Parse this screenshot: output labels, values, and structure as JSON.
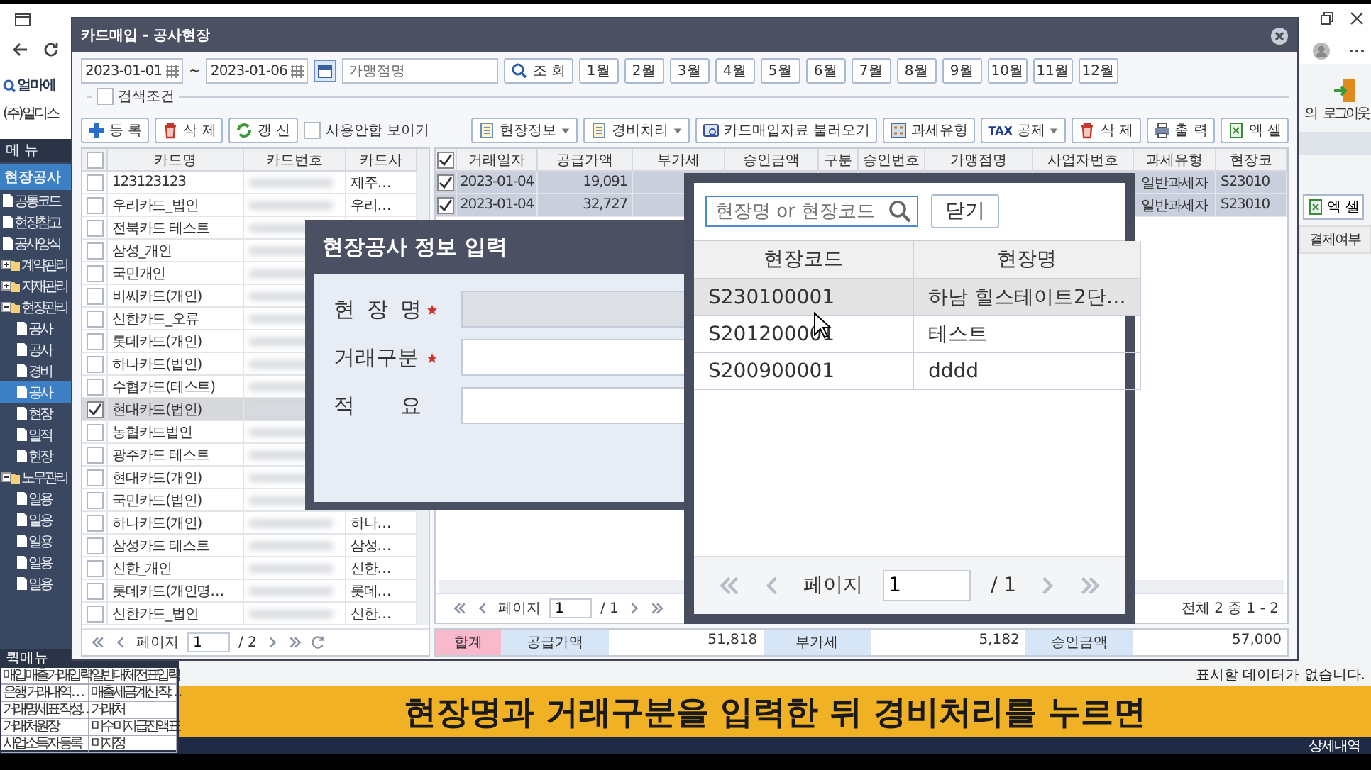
{
  "background_app": {
    "logo": "얼마에",
    "company": "(주)얼디스",
    "menu_header": "메 뉴",
    "section": "현장공사",
    "tree": [
      {
        "label": "공통코드",
        "kind": "doc",
        "selected": false
      },
      {
        "label": "현장참고",
        "kind": "doc",
        "selected": false
      },
      {
        "label": "공사양식",
        "kind": "doc",
        "selected": false
      },
      {
        "label": "계약관리",
        "kind": "folder",
        "expanded": false,
        "selected": false
      },
      {
        "label": "자재관리",
        "kind": "folder",
        "expanded": false,
        "selected": false
      },
      {
        "label": "현장관리",
        "kind": "folder",
        "expanded": true,
        "selected": false,
        "children": [
          {
            "label": "공사",
            "kind": "doc",
            "selected": false
          },
          {
            "label": "공사",
            "kind": "doc",
            "selected": false
          },
          {
            "label": "경비",
            "kind": "doc",
            "selected": false
          },
          {
            "label": "공사",
            "kind": "doc",
            "selected": true
          },
          {
            "label": "현장",
            "kind": "doc",
            "selected": false
          },
          {
            "label": "일적",
            "kind": "doc",
            "selected": false
          },
          {
            "label": "현장",
            "kind": "doc",
            "selected": false
          }
        ]
      },
      {
        "label": "노무관리",
        "kind": "folder",
        "expanded": true,
        "selected": false,
        "children": [
          {
            "label": "일용",
            "kind": "doc",
            "selected": false
          },
          {
            "label": "일용",
            "kind": "doc",
            "selected": false
          },
          {
            "label": "일용",
            "kind": "doc",
            "selected": false
          },
          {
            "label": "일용",
            "kind": "doc",
            "selected": false
          },
          {
            "label": "일용",
            "kind": "doc",
            "selected": false
          }
        ]
      }
    ],
    "header_actions": [
      "의",
      "로그아웃"
    ],
    "excel_button": "엑 셀",
    "column_header": "결제여부",
    "empty_message": "표시할 데이터가 없습니다.",
    "detail_label": "상세내역"
  },
  "quick_menu": {
    "title": "퀵메뉴",
    "items": [
      "매입매출거래입력",
      "일반대체전표입력",
      "은행 거래내역 …",
      "매출세금계산 작…",
      "거래명세표 작성…",
      "거래처",
      "거래처원장",
      "미수미지급잔액표",
      "사업소득자 등록",
      "미지정"
    ]
  },
  "main_window": {
    "title": "카드매입 - 공사현장",
    "date_from": "2023-01-01",
    "date_separator": "~",
    "date_to": "2023-01-06",
    "merchant_field": {
      "placeholder": "가맹점명"
    },
    "search_button": "조 회",
    "months": [
      "1월",
      "2월",
      "3월",
      "4월",
      "5월",
      "6월",
      "7월",
      "8월",
      "9월",
      "10월",
      "11월",
      "12월"
    ],
    "search_conditions": {
      "label": "검색조건",
      "checked": false
    },
    "left_toolbar": [
      {
        "label": "등 록",
        "kind": "add"
      },
      {
        "label": "삭 제",
        "kind": "delete"
      },
      {
        "label": "갱 신",
        "kind": "refresh"
      }
    ],
    "show_unused": {
      "label": "사용안함 보이기",
      "checked": false
    },
    "right_toolbar": [
      {
        "label": "현장정보",
        "kind": "dropdown"
      },
      {
        "label": "경비처리",
        "kind": "dropdown"
      },
      {
        "label": "카드매입자료 불러오기",
        "kind": "import"
      },
      {
        "label": "과세유형",
        "kind": "tax-type"
      },
      {
        "label": "공제",
        "kind": "tax",
        "badge": "TAX"
      },
      {
        "label": "삭 제",
        "kind": "delete"
      },
      {
        "label": "출 력",
        "kind": "print"
      },
      {
        "label": "엑 셀",
        "kind": "excel"
      }
    ],
    "card_table": {
      "header_checked": false,
      "columns": [
        "카드명",
        "카드번호",
        "카드사"
      ],
      "rows": [
        {
          "name": "123123123",
          "company": "제주…",
          "checked": false,
          "selected": false
        },
        {
          "name": "우리카드_법인",
          "company": "우리…",
          "checked": false,
          "selected": false
        },
        {
          "name": "전북카드 테스트",
          "checked": false,
          "selected": false
        },
        {
          "name": "삼성_개인",
          "checked": false,
          "selected": false
        },
        {
          "name": "국민개인",
          "checked": false,
          "selected": false
        },
        {
          "name": "비씨카드(개인)",
          "checked": false,
          "selected": false
        },
        {
          "name": "신한카드_오류",
          "checked": false,
          "selected": false
        },
        {
          "name": "롯데카드(개인)",
          "checked": false,
          "selected": false
        },
        {
          "name": "하나카드(법인)",
          "checked": false,
          "selected": false
        },
        {
          "name": "수협카드(테스트)",
          "checked": false,
          "selected": false
        },
        {
          "name": "현대카드(법인)",
          "checked": true,
          "selected": true
        },
        {
          "name": "농협카드법인",
          "checked": false,
          "selected": false
        },
        {
          "name": "광주카드 테스트",
          "checked": false,
          "selected": false
        },
        {
          "name": "현대카드(개인)",
          "checked": false,
          "selected": false
        },
        {
          "name": "국민카드(법인)",
          "checked": false,
          "selected": false
        },
        {
          "name": "하나카드(개인)",
          "company": "하나…",
          "checked": false,
          "selected": false
        },
        {
          "name": "삼성카드 테스트",
          "company": "삼성…",
          "checked": false,
          "selected": false
        },
        {
          "name": "신한_개인",
          "company": "신한…",
          "checked": false,
          "selected": false
        },
        {
          "name": "롯데카드(개인명…",
          "company": "롯데…",
          "checked": false,
          "selected": false
        },
        {
          "name": "신한카드_법인",
          "company": "신한…",
          "checked": false,
          "selected": false
        }
      ],
      "pager": {
        "label": "페이지",
        "page": "1",
        "total": "/ 2"
      }
    },
    "transactions": {
      "header_checked": true,
      "columns": [
        "거래일자",
        "공급가액",
        "부가세",
        "승인금액",
        "구분",
        "승인번호",
        "가맹점명",
        "사업자번호",
        "과세유형",
        "현장코"
      ],
      "rows": [
        {
          "checked": true,
          "date": "2023-01-04",
          "supply_amount": "19,091",
          "tax_type": "일반과세자",
          "site_code": "S23010"
        },
        {
          "checked": true,
          "date": "2023-01-04",
          "supply_amount": "32,727",
          "tax_type": "일반과세자",
          "site_code": "S23010"
        }
      ],
      "pager": {
        "label": "페이지",
        "page": "1",
        "total": "/ 1",
        "summary": "전체 2 중 1 - 2"
      },
      "total_label": "합계",
      "totals": [
        {
          "label": "공급가액",
          "value": "51,818"
        },
        {
          "label": "부가세",
          "value": "5,182"
        },
        {
          "label": "승인금액",
          "value": "57,000"
        }
      ]
    }
  },
  "site_dialog": {
    "title": "현장공사 정보 입력",
    "fields": [
      {
        "label": "현 장 명",
        "required": true,
        "disabled": true
      },
      {
        "label": "거래구분",
        "required": true,
        "disabled": false
      },
      {
        "label": "적 요",
        "required": false,
        "disabled": false
      }
    ]
  },
  "site_picker": {
    "search": {
      "placeholder": "현장명 or 현장코드"
    },
    "close_button": "닫기",
    "columns": [
      "현장코드",
      "현장명"
    ],
    "rows": [
      {
        "code": "S230100001",
        "name": "하남 힐스테이트2단…",
        "hovered": true
      },
      {
        "code": "S201200001",
        "name": "테스트",
        "hovered": false
      },
      {
        "code": "S200900001",
        "name": "dddd",
        "hovered": false
      }
    ],
    "pager": {
      "label": "페이지",
      "page": "1",
      "total": "/ 1"
    }
  },
  "caption": "현장명과 거래구분을 입력한 뒤 경비처리를 누르면"
}
